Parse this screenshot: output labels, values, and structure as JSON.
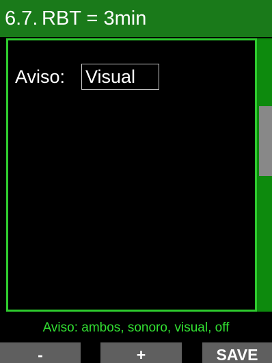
{
  "header": {
    "position": "6.7.",
    "title": "RBT = 3min"
  },
  "setting": {
    "label": "Aviso:",
    "value": "Visual"
  },
  "hint": "Aviso: ambos, sonoro, visual, off",
  "softkeys": {
    "minus": "-",
    "plus": "+",
    "save": "SAVE"
  },
  "colors": {
    "title_bar": "#1a7a1a",
    "accent": "#2ecc2e",
    "hint_text": "#32e032",
    "softkey": "#5f5f5f"
  }
}
